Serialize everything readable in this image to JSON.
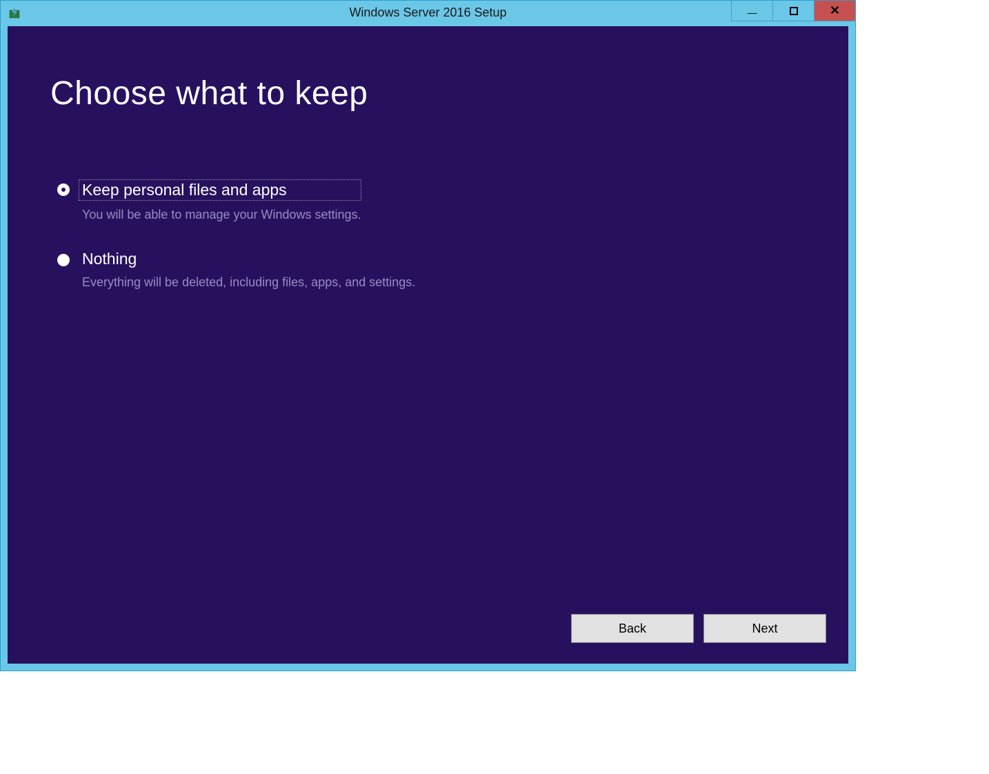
{
  "window": {
    "title": "Windows Server 2016 Setup"
  },
  "page": {
    "heading": "Choose what to keep"
  },
  "options": [
    {
      "label": "Keep personal files and apps",
      "description": "You will be able to manage your Windows settings.",
      "selected": true
    },
    {
      "label": "Nothing",
      "description": "Everything will be deleted, including files, apps, and settings.",
      "selected": false
    }
  ],
  "buttons": {
    "back": "Back",
    "next": "Next"
  }
}
